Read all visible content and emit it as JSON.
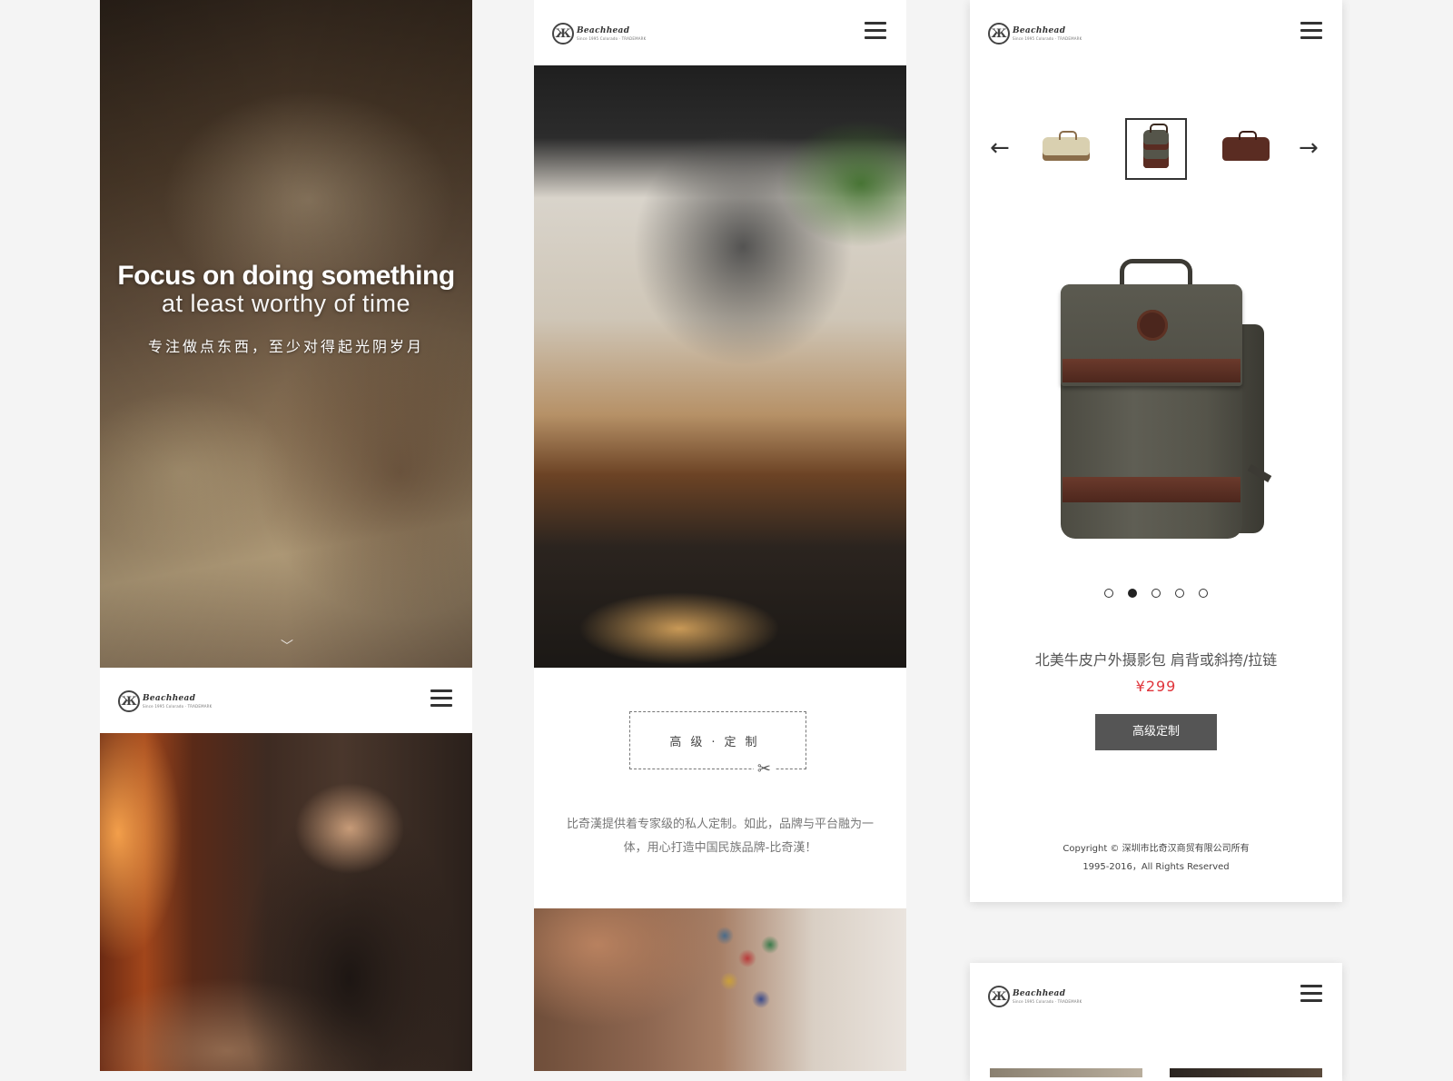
{
  "brand": {
    "logo_word": "Beachhead",
    "logo_mark": "Ж",
    "logo_tag": "Since 1995 Colorado · TRADEMARK"
  },
  "hero": {
    "title": "Focus on doing something",
    "subtitle": "at least worthy of time",
    "slogan_cn": "专注做点东西，至少对得起光阴岁月",
    "scroll_icon": "chevron-down-icon",
    "scroll_glyph": "﹀"
  },
  "custom_section": {
    "label": "高级·定制",
    "scissors_glyph": "✂",
    "description": "比奇漢提供着专家级的私人定制。如此，品牌与平台融为一体，用心打造中国民族品牌-比奇漢！"
  },
  "product": {
    "prev_arrow": "←",
    "next_arrow": "→",
    "thumbnails": [
      "beige-messenger-bag",
      "olive-backpack",
      "brown-messenger-bag"
    ],
    "active_thumbnail": 1,
    "slide_count": 5,
    "active_slide": 1,
    "name": "北美牛皮户外摄影包  肩背或斜挎/拉链",
    "price": "¥299",
    "button_label": "高级定制"
  },
  "footer": {
    "copyright_line1": "Copyright © 深圳市比奇汉商贸有限公司所有",
    "copyright_line2": "1995-2016，All Rights Reserved"
  },
  "colors": {
    "price": "#e0353b",
    "button_bg": "#555555",
    "text_dark": "#333333"
  }
}
